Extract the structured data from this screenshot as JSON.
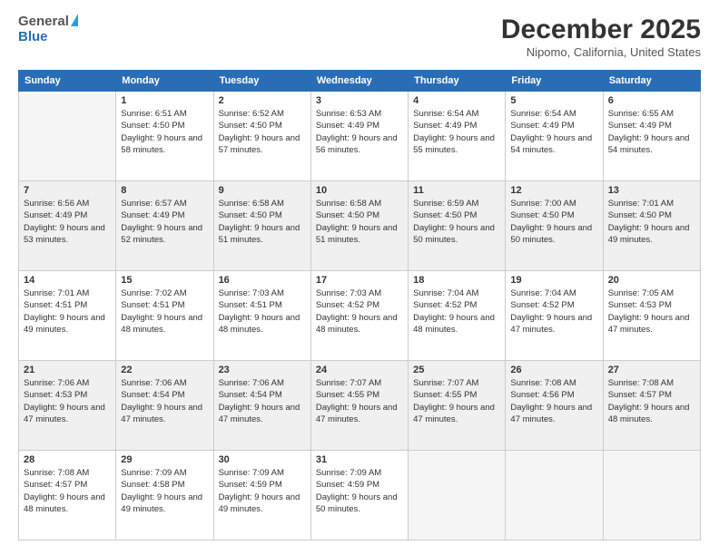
{
  "logo": {
    "general": "General",
    "blue": "Blue"
  },
  "title": "December 2025",
  "subtitle": "Nipomo, California, United States",
  "days_of_week": [
    "Sunday",
    "Monday",
    "Tuesday",
    "Wednesday",
    "Thursday",
    "Friday",
    "Saturday"
  ],
  "weeks": [
    [
      {
        "num": "",
        "empty": true
      },
      {
        "num": "1",
        "sunrise": "6:51 AM",
        "sunset": "4:50 PM",
        "daylight": "9 hours and 58 minutes."
      },
      {
        "num": "2",
        "sunrise": "6:52 AM",
        "sunset": "4:50 PM",
        "daylight": "9 hours and 57 minutes."
      },
      {
        "num": "3",
        "sunrise": "6:53 AM",
        "sunset": "4:49 PM",
        "daylight": "9 hours and 56 minutes."
      },
      {
        "num": "4",
        "sunrise": "6:54 AM",
        "sunset": "4:49 PM",
        "daylight": "9 hours and 55 minutes."
      },
      {
        "num": "5",
        "sunrise": "6:54 AM",
        "sunset": "4:49 PM",
        "daylight": "9 hours and 54 minutes."
      },
      {
        "num": "6",
        "sunrise": "6:55 AM",
        "sunset": "4:49 PM",
        "daylight": "9 hours and 54 minutes."
      }
    ],
    [
      {
        "num": "7",
        "sunrise": "6:56 AM",
        "sunset": "4:49 PM",
        "daylight": "9 hours and 53 minutes."
      },
      {
        "num": "8",
        "sunrise": "6:57 AM",
        "sunset": "4:49 PM",
        "daylight": "9 hours and 52 minutes."
      },
      {
        "num": "9",
        "sunrise": "6:58 AM",
        "sunset": "4:50 PM",
        "daylight": "9 hours and 51 minutes."
      },
      {
        "num": "10",
        "sunrise": "6:58 AM",
        "sunset": "4:50 PM",
        "daylight": "9 hours and 51 minutes."
      },
      {
        "num": "11",
        "sunrise": "6:59 AM",
        "sunset": "4:50 PM",
        "daylight": "9 hours and 50 minutes."
      },
      {
        "num": "12",
        "sunrise": "7:00 AM",
        "sunset": "4:50 PM",
        "daylight": "9 hours and 50 minutes."
      },
      {
        "num": "13",
        "sunrise": "7:01 AM",
        "sunset": "4:50 PM",
        "daylight": "9 hours and 49 minutes."
      }
    ],
    [
      {
        "num": "14",
        "sunrise": "7:01 AM",
        "sunset": "4:51 PM",
        "daylight": "9 hours and 49 minutes."
      },
      {
        "num": "15",
        "sunrise": "7:02 AM",
        "sunset": "4:51 PM",
        "daylight": "9 hours and 48 minutes."
      },
      {
        "num": "16",
        "sunrise": "7:03 AM",
        "sunset": "4:51 PM",
        "daylight": "9 hours and 48 minutes."
      },
      {
        "num": "17",
        "sunrise": "7:03 AM",
        "sunset": "4:52 PM",
        "daylight": "9 hours and 48 minutes."
      },
      {
        "num": "18",
        "sunrise": "7:04 AM",
        "sunset": "4:52 PM",
        "daylight": "9 hours and 48 minutes."
      },
      {
        "num": "19",
        "sunrise": "7:04 AM",
        "sunset": "4:52 PM",
        "daylight": "9 hours and 47 minutes."
      },
      {
        "num": "20",
        "sunrise": "7:05 AM",
        "sunset": "4:53 PM",
        "daylight": "9 hours and 47 minutes."
      }
    ],
    [
      {
        "num": "21",
        "sunrise": "7:06 AM",
        "sunset": "4:53 PM",
        "daylight": "9 hours and 47 minutes."
      },
      {
        "num": "22",
        "sunrise": "7:06 AM",
        "sunset": "4:54 PM",
        "daylight": "9 hours and 47 minutes."
      },
      {
        "num": "23",
        "sunrise": "7:06 AM",
        "sunset": "4:54 PM",
        "daylight": "9 hours and 47 minutes."
      },
      {
        "num": "24",
        "sunrise": "7:07 AM",
        "sunset": "4:55 PM",
        "daylight": "9 hours and 47 minutes."
      },
      {
        "num": "25",
        "sunrise": "7:07 AM",
        "sunset": "4:55 PM",
        "daylight": "9 hours and 47 minutes."
      },
      {
        "num": "26",
        "sunrise": "7:08 AM",
        "sunset": "4:56 PM",
        "daylight": "9 hours and 47 minutes."
      },
      {
        "num": "27",
        "sunrise": "7:08 AM",
        "sunset": "4:57 PM",
        "daylight": "9 hours and 48 minutes."
      }
    ],
    [
      {
        "num": "28",
        "sunrise": "7:08 AM",
        "sunset": "4:57 PM",
        "daylight": "9 hours and 48 minutes."
      },
      {
        "num": "29",
        "sunrise": "7:09 AM",
        "sunset": "4:58 PM",
        "daylight": "9 hours and 49 minutes."
      },
      {
        "num": "30",
        "sunrise": "7:09 AM",
        "sunset": "4:59 PM",
        "daylight": "9 hours and 49 minutes."
      },
      {
        "num": "31",
        "sunrise": "7:09 AM",
        "sunset": "4:59 PM",
        "daylight": "9 hours and 50 minutes."
      },
      {
        "num": "",
        "empty": true
      },
      {
        "num": "",
        "empty": true
      },
      {
        "num": "",
        "empty": true
      }
    ]
  ]
}
